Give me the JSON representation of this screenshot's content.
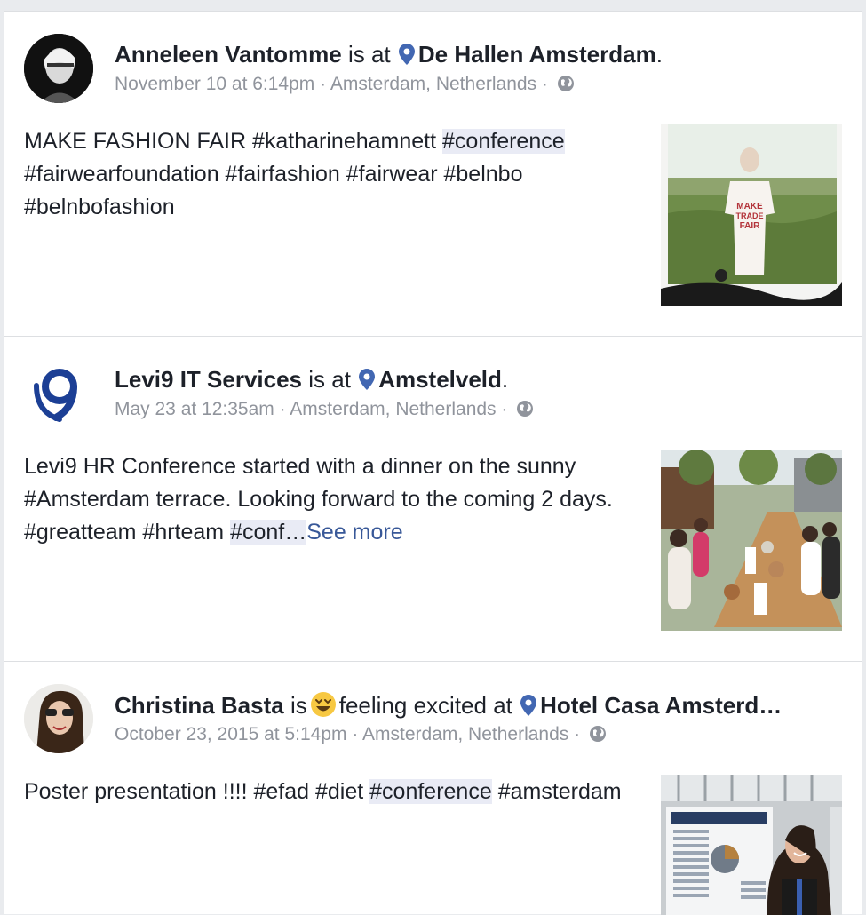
{
  "posts": [
    {
      "author": "Anneleen Vantomme",
      "connector": "is at",
      "place": "De Hallen Amsterdam",
      "place_suffix": ".",
      "date": "November 10 at 6:14pm",
      "location": "Amsterdam, Netherlands",
      "sep": " · ",
      "text_a": "MAKE FASHION FAIR #katharinehamnett ",
      "text_hl": "#conference",
      "text_b": " #fairwearfoundation #fairfashion #fairwear #belnbo #belnbofashion",
      "thumb_label_1": "MAKE",
      "thumb_label_2": "TRADE",
      "thumb_label_3": "FAIR"
    },
    {
      "author": "Levi9 IT Services",
      "connector": "is at",
      "place": "Amstelveld",
      "place_suffix": ".",
      "date": "May 23 at 12:35am",
      "location": "Amsterdam, Netherlands",
      "sep": " · ",
      "text_a": "Levi9 HR Conference started with a dinner on the sunny #Amsterdam terrace. Looking forward to the coming 2 days. #greatteam #hrteam ",
      "text_hl": "#conf…",
      "see_more": "See more"
    },
    {
      "author": "Christina Basta",
      "connector": "is",
      "feeling": "feeling excited at",
      "place": "Hotel Casa Amsterd…",
      "date": "October 23, 2015 at 5:14pm",
      "location": "Amsterdam, Netherlands",
      "sep": " · ",
      "text_a": "Poster presentation !!!! #efad #diet ",
      "text_hl": "#conference",
      "text_b": " #amsterdam"
    }
  ],
  "colors": {
    "link": "#385898",
    "pin": "#4267b2",
    "levi_blue": "#1c3f95",
    "meta": "#90949c"
  }
}
